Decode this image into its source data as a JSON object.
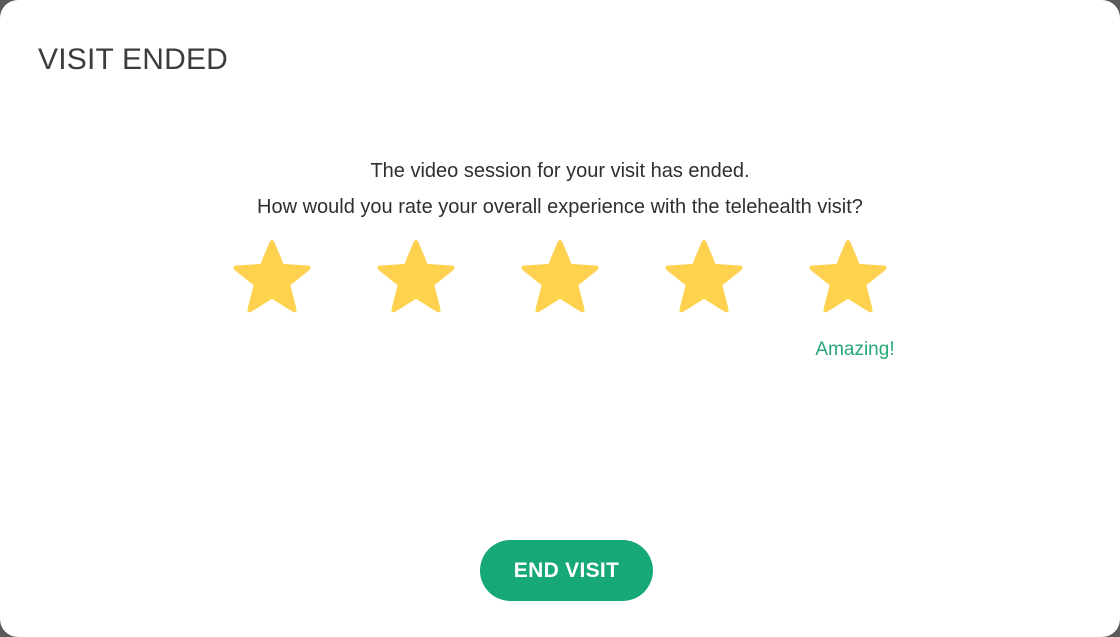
{
  "dialog": {
    "title": "VISIT ENDED",
    "message_line1": "The video session for your visit has ended.",
    "message_line2": "How would you rate your overall experience with the telehealth visit?"
  },
  "rating": {
    "max": 5,
    "selected": 5,
    "selected_label": "Amazing!",
    "star_icon": "star-icon",
    "star_color": "#FED14F",
    "label_color": "#27A877"
  },
  "actions": {
    "end_visit_label": "END VISIT",
    "button_color": "#16A879"
  }
}
